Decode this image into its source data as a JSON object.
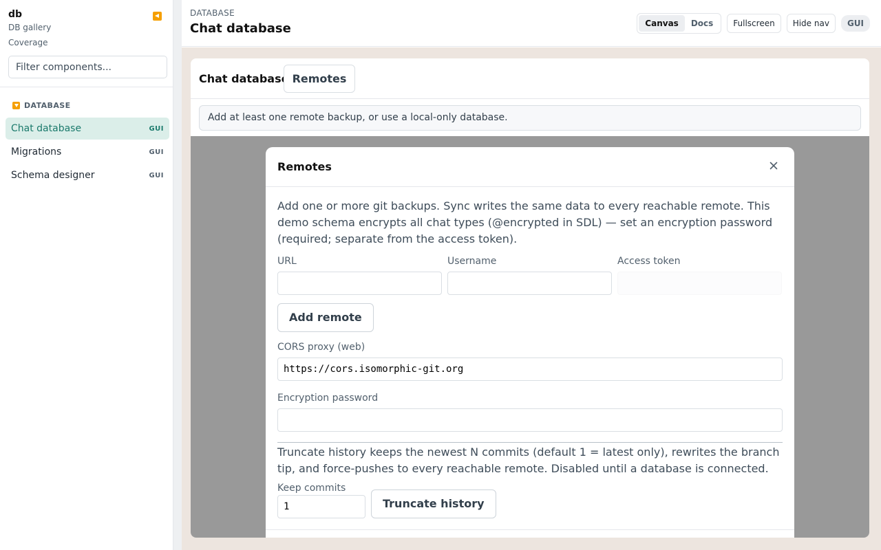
{
  "sidebar": {
    "title": "db",
    "subtitle": "DB gallery",
    "link": "Coverage",
    "filter_placeholder": "Filter components...",
    "section": "DATABASE",
    "items": [
      {
        "label": "Chat database",
        "badge": "GUI",
        "active": true
      },
      {
        "label": "Migrations",
        "badge": "GUI",
        "active": false
      },
      {
        "label": "Schema designer",
        "badge": "GUI",
        "active": false
      }
    ]
  },
  "header": {
    "eyebrow": "DATABASE",
    "title": "Chat database",
    "toggle": {
      "canvas": "Canvas",
      "docs": "Docs",
      "selected": "Canvas"
    },
    "fullscreen": "Fullscreen",
    "hide_nav": "Hide nav",
    "badge": "GUI"
  },
  "card": {
    "title": "Chat database",
    "tab": "Remotes",
    "notice": "Add at least one remote backup, or use a local-only database."
  },
  "modal": {
    "title": "Remotes",
    "description": "Add one or more git backups. Sync writes the same data to every reachable remote. This demo schema encrypts all chat types (@encrypted in SDL) — set an encryption password (required; separate from the access token).",
    "url_label": "URL",
    "url_value": "",
    "username_label": "Username",
    "username_value": "",
    "token_label": "Access token",
    "token_value": "",
    "add_remote": "Add remote",
    "cors_label": "CORS proxy (web)",
    "cors_value": "https://cors.isomorphic-git.org",
    "password_label": "Encryption password",
    "password_value": "",
    "truncate_description": "Truncate history keeps the newest N commits (default 1 = latest only), rewrites the branch tip, and force-pushes to every reachable remote. Disabled until a database is connected.",
    "keep_label": "Keep commits",
    "keep_value": "1",
    "truncate_button": "Truncate history"
  },
  "colors": {
    "accent": "#1b7a6c",
    "active_bg": "#dbeee9",
    "brand_icon": "#f59f00",
    "overlay": "#999999",
    "page_bg": "#ede5df"
  },
  "icons": {
    "collapse": "collapse-left-icon",
    "section": "chevron-down-icon",
    "close": "close-icon"
  }
}
